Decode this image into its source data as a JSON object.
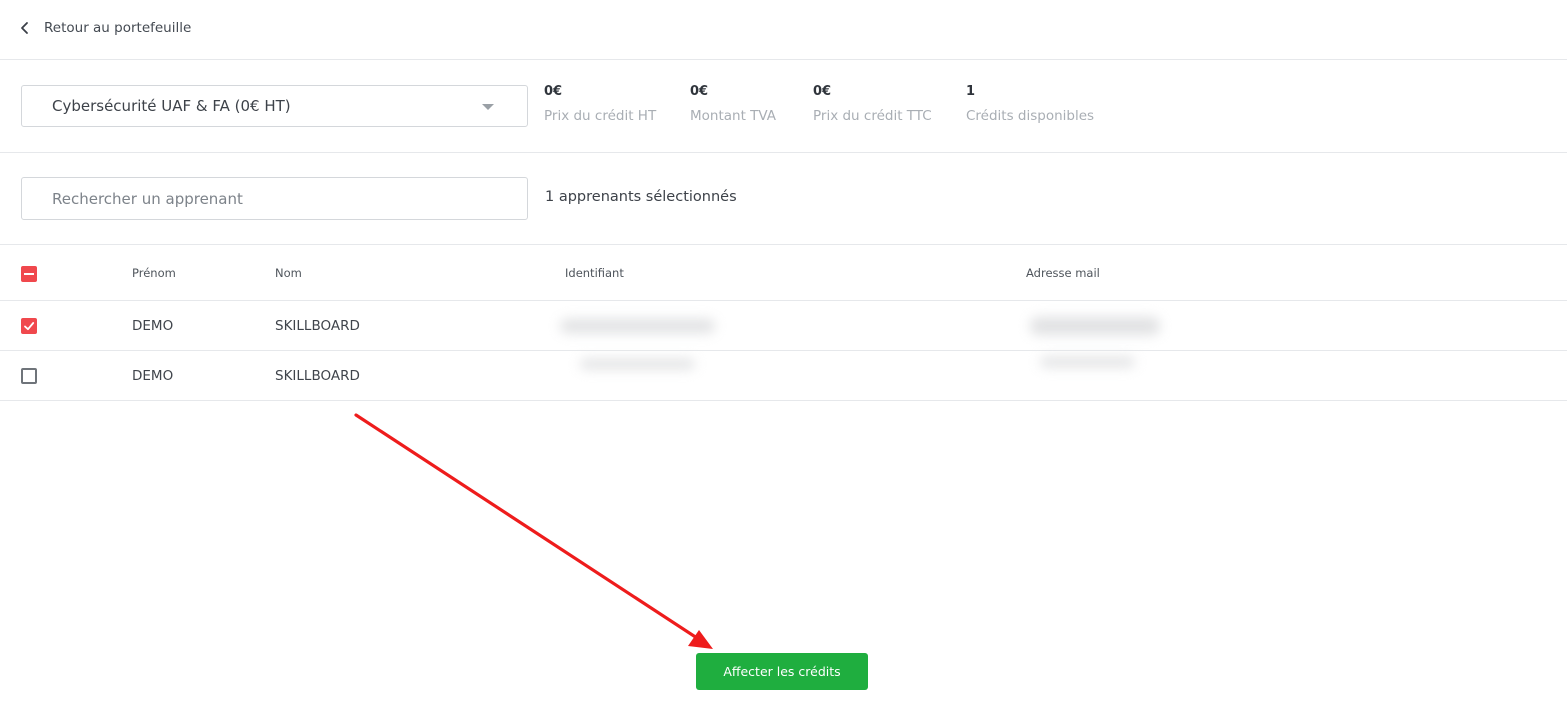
{
  "header": {
    "back_label": "Retour au portefeuille"
  },
  "credit": {
    "selected_offer": "Cybersécurité UAF & FA (0€ HT)",
    "stats": [
      {
        "value": "0€",
        "label": "Prix du crédit HT"
      },
      {
        "value": "0€",
        "label": "Montant TVA"
      },
      {
        "value": "0€",
        "label": "Prix du crédit TTC"
      },
      {
        "value": "1",
        "label": "Crédits disponibles"
      }
    ]
  },
  "search": {
    "placeholder": "Rechercher un apprenant",
    "selected_count_text": "1 apprenants sélectionnés"
  },
  "table": {
    "columns": [
      "Prénom",
      "Nom",
      "Identifiant",
      "Adresse mail"
    ],
    "rows": [
      {
        "checked": true,
        "prenom": "DEMO",
        "nom": "SKILLBOARD"
      },
      {
        "checked": false,
        "prenom": "DEMO",
        "nom": "SKILLBOARD"
      }
    ]
  },
  "actions": {
    "assign_label": "Affecter les crédits"
  },
  "colors": {
    "accent_red": "#f0484d",
    "primary_green": "#1fae3f",
    "annotation_red": "#ee1c1c"
  }
}
